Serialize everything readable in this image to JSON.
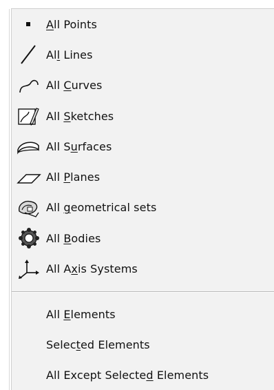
{
  "menu": {
    "items": [
      {
        "pre": "",
        "mn": "A",
        "post": "ll Points",
        "icon": "point-icon"
      },
      {
        "pre": "Al",
        "mn": "l",
        "post": " Lines",
        "icon": "line-icon"
      },
      {
        "pre": "All ",
        "mn": "C",
        "post": "urves",
        "icon": "curve-icon"
      },
      {
        "pre": "All ",
        "mn": "S",
        "post": "ketches",
        "icon": "sketch-icon"
      },
      {
        "pre": "All S",
        "mn": "u",
        "post": "rfaces",
        "icon": "surface-icon"
      },
      {
        "pre": "All ",
        "mn": "P",
        "post": "lanes",
        "icon": "plane-icon"
      },
      {
        "pre": "All ",
        "mn": "g",
        "post": "eometrical sets",
        "icon": "geometrical-set-icon"
      },
      {
        "pre": "All ",
        "mn": "B",
        "post": "odies",
        "icon": "bodies-icon"
      },
      {
        "pre": "All A",
        "mn": "x",
        "post": "is Systems",
        "icon": "axis-system-icon"
      }
    ],
    "bottom_items": [
      {
        "pre": "All ",
        "mn": "E",
        "post": "lements"
      },
      {
        "pre": "Selec",
        "mn": "t",
        "post": "ed Elements"
      },
      {
        "pre": "All Except Selecte",
        "mn": "d",
        "post": " Elements"
      }
    ]
  }
}
